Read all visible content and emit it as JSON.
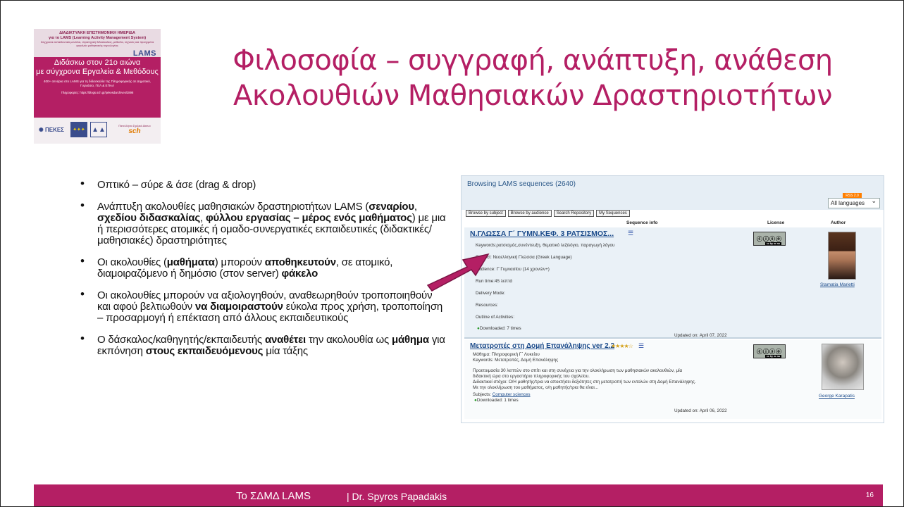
{
  "poster": {
    "line1": "ΔΙΑΔΙΚΤΥΑΚΗ ΕΠΙΣΤΗΜΟΝΙΚΗ ΗΜΕΡΙΔΑ",
    "line2": "για το LAMS (Learning Activity Management System)",
    "line3": "Σύγχρονα εκπαιδευτικά μοντέλα, στρατηγική διδασκαλίας, μέθοδοι, τεχνικές και προηγμένα εργαλεία μαθησιακής τεχνολογίας",
    "lams": "LAMS",
    "main1": "Διδάσκω στον 21ο αιώνα",
    "main2": "με σύγχρονα Εργαλεία & Μεθόδους",
    "main3": "400+ σενάρια στο LAMS για τη διδασκαλία της Πληροφορικής σε Δημοτικό, Γυμνάσιο, ΓΕΛ & ΕΠΑΛ",
    "main4": "Πληροφορίες: https://blogs.sch.gr/pekesdarchives/2898",
    "logo_pekes": "ΠΕΚΕΣ",
    "logo_sch_top": "Πανελλήνιο Σχολικό Δίκτυο",
    "logo_sch": "sch"
  },
  "title": {
    "line1": "Φιλοσοφία – συγγραφή, ανάπτυξη, ανάθεση",
    "line2": "Ακολουθιών Μαθησιακών Δραστηριοτήτων"
  },
  "bullets": [
    {
      "parts": [
        [
          "n",
          "Οπτικό – σύρε & άσε (drag & drop)"
        ]
      ]
    },
    {
      "parts": [
        [
          "n",
          "Ανάπτυξη ακολουθίες μαθησιακών δραστηριοτήτων LAMS ("
        ],
        [
          "b",
          "σεναρίου"
        ],
        [
          "n",
          ", "
        ],
        [
          "b",
          "σχεδίου διδασκαλίας"
        ],
        [
          "n",
          ", "
        ],
        [
          "b",
          "φύλλου εργασίας – μέρος ενός μαθήματος"
        ],
        [
          "n",
          ") με μια ή περισσότερες ατομικές ή ομαδο-συνεργατικές εκπαιδευτικές (διδακτικές/μαθησιακές) δραστηριότητες"
        ]
      ]
    },
    {
      "parts": [
        [
          "n",
          "Οι ακολουθίες ("
        ],
        [
          "b",
          "μαθήματα"
        ],
        [
          "n",
          ") μπορούν "
        ],
        [
          "b",
          "αποθηκευτούν"
        ],
        [
          "n",
          ", σε ατομικό, διαμοιραζόμενο ή δημόσιο (στον server) "
        ],
        [
          "b",
          "φάκελο"
        ]
      ]
    },
    {
      "parts": [
        [
          "n",
          "Οι ακολουθίες μπορούν να αξιολογηθούν, αναθεωρηθούν τροποποιηθούν και αφού βελτιωθούν "
        ],
        [
          "b",
          "να διαμοιραστούν"
        ],
        [
          "n",
          " εύκολα προς χρήση, τροποποίηση – προσαρμογή ή επέκταση από άλλους εκπαιδευτικούς"
        ]
      ]
    },
    {
      "parts": [
        [
          "n",
          "Ο δάσκαλος/καθηγητής/εκπαιδευτής "
        ],
        [
          "b",
          "αναθέτει"
        ],
        [
          "n",
          " την ακολουθία ως "
        ],
        [
          "b",
          "μάθημα"
        ],
        [
          "n",
          " για εκπόνηση "
        ],
        [
          "b",
          "στους εκπαιδευόμενους"
        ],
        [
          "n",
          " μία τάξης"
        ]
      ]
    }
  ],
  "shot": {
    "browsing": "Browsing LAMS sequences (2640)",
    "rss": "RSS 2.0",
    "language": "All languages",
    "tabs": [
      "Browse by subject",
      "Browse by audience",
      "Search Repository",
      "My Sequences"
    ],
    "col_info": "Sequence info",
    "col_license": "License",
    "col_author": "Author",
    "seq1": {
      "title": "Ν.ΓΛΩΣΣΑ Γ΄ ΓΥΜΝ.ΚΕΦ. 3 ΡΑΤΣΙΣΜΟΣ...",
      "keywords": "Keywords:ρατσισμός,συνέντευξη, θεματικό λεξιλόγιο, παραγωγή λόγου",
      "subject": "Subject: Νεοελληνική Γλώσσα (Greek Language)",
      "audience": "Audience: Γ΄Γυμνασίου (14 χρονών+)",
      "runtime": "Run time:45 λεπτά",
      "delivery": "Delivery Mode:",
      "resources": "Resources:",
      "outline": "Outline of Activities:",
      "downloaded": "Downloaded: 7 times",
      "updated": "Updated on: April 07, 2022",
      "author": "Stamatia Marietti",
      "license": "cc by nc sa"
    },
    "seq2": {
      "title": "Μετατροπές στη Δομή Επανάληψης ver 2.2",
      "stars": "★★★★☆",
      "course": "Μάθημα: Πληροφορική Γ΄ Λυκείου",
      "keywords": "Keywords: Μετατροπές, Δομή Επανάληψης",
      "desc1": "Προετοιμασία 30 λεπτών στο σπίτι και στη συνέχεια για την ολοκλήρωση των μαθησιακών ακολουθιών, μία",
      "desc2": "διδακτική ώρα στο εργαστήριο πληροφορικής του σχολείου.",
      "desc3": "Διδακτικοί στόχοι: Ο/Η μαθητής/τρια να αποκτήσει δεξιότητες στη μετατροπή των εντολών στη Δομή Επανάληψης.",
      "desc4": "Με την ολοκλήρωση του μαθήματος, ο/η μαθητής/τρια θα είναι...",
      "subjects_label": "Subjects: ",
      "subjects_link": "Computer sciences",
      "downloaded": "Downloaded: 1 times",
      "updated": "Updated on: April 06, 2022",
      "author": "George Karapatis",
      "license": "cc by nc sa"
    }
  },
  "colors": {
    "accent": "#b41f64",
    "link": "#1a4a8a"
  },
  "footer": {
    "left": "Το ΣΔΜΔ LAMS",
    "center": "| Dr. Spyros Papadakis",
    "page": "16"
  }
}
